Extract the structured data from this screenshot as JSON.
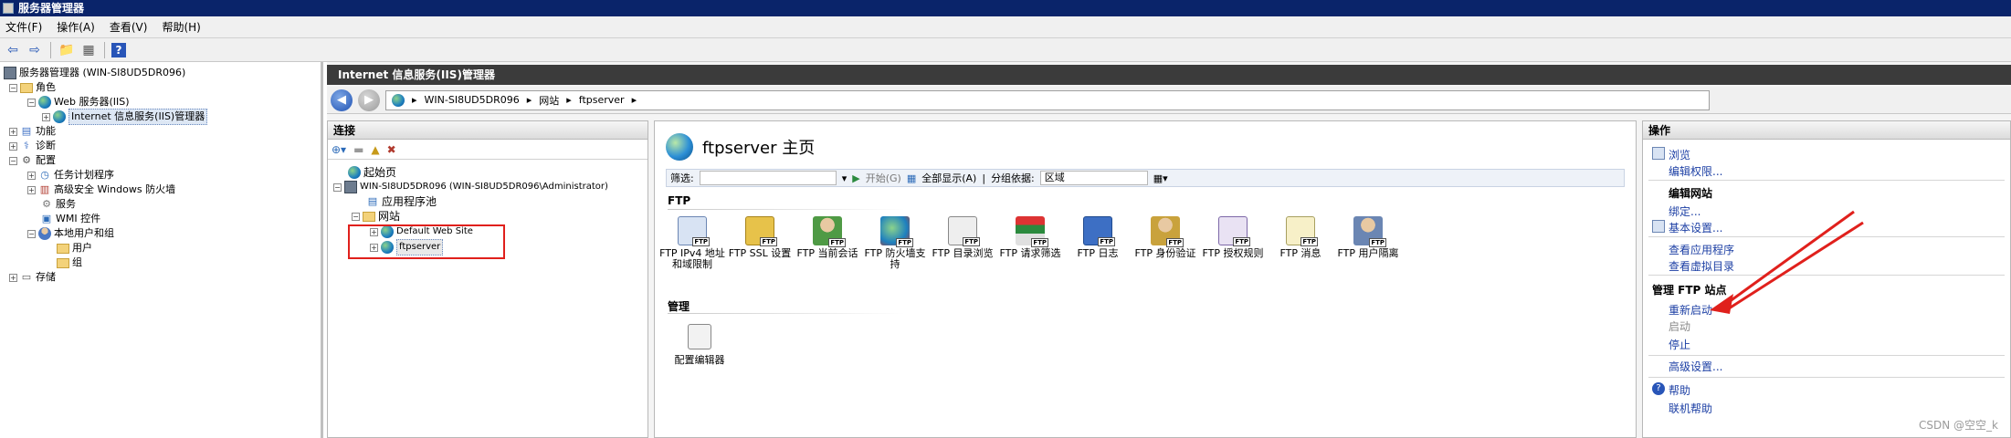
{
  "window": {
    "title": "服务器管理器"
  },
  "menu": [
    "文件(F)",
    "操作(A)",
    "查看(V)",
    "帮助(H)"
  ],
  "tree": {
    "root": "服务器管理器 (WIN-SI8UD5DR096)",
    "roles": "角色",
    "web_server": "Web 服务器(IIS)",
    "iis_manager": "Internet 信息服务(IIS)管理器",
    "features": "功能",
    "diagnostics": "诊断",
    "config": "配置",
    "task_scheduler": "任务计划程序",
    "firewall": "高级安全 Windows 防火墙",
    "services": "服务",
    "wmi": "WMI 控件",
    "local_users": "本地用户和组",
    "users": "用户",
    "groups": "组",
    "storage": "存储"
  },
  "iis": {
    "header": "Internet 信息服务(IIS)管理器",
    "breadcrumb": [
      "WIN-SI8UD5DR096",
      "网站",
      "ftpserver"
    ],
    "connections": {
      "title": "连接",
      "start_page": "起始页",
      "server": "WIN-SI8UD5DR096 (WIN-SI8UD5DR096\\Administrator)",
      "app_pools": "应用程序池",
      "sites": "网站",
      "default_site": "Default Web Site",
      "ftp_site": "ftpserver"
    },
    "home": {
      "title": "ftpserver 主页",
      "filter_label": "筛选:",
      "go_label": "开始(G)",
      "show_all_label": "全部显示(A)",
      "group_by_label": "分组依据:",
      "group_by_value": "区域",
      "section_ftp": "FTP",
      "section_manage": "管理",
      "features": [
        "FTP IPv4 地址和域限制",
        "FTP SSL 设置",
        "FTP 当前会话",
        "FTP 防火墙支持",
        "FTP 目录浏览",
        "FTP 请求筛选",
        "FTP 日志",
        "FTP 身份验证",
        "FTP 授权规则",
        "FTP 消息",
        "FTP 用户隔离"
      ],
      "config_editor": "配置编辑器"
    },
    "actions": {
      "title": "操作",
      "browse": "浏览",
      "edit_permissions": "编辑权限...",
      "edit_site_head": "编辑网站",
      "bindings": "绑定...",
      "basic_settings": "基本设置...",
      "view_apps": "查看应用程序",
      "view_vdirs": "查看虚拟目录",
      "manage_ftp_head": "管理 FTP 站点",
      "restart": "重新启动",
      "start": "启动",
      "stop": "停止",
      "advanced": "高级设置...",
      "help": "帮助",
      "online_help": "联机帮助"
    }
  },
  "watermark": "CSDN @空空_k"
}
